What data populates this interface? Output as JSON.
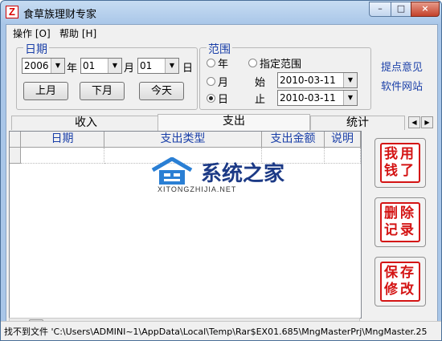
{
  "window": {
    "title": "食草族理财专家",
    "min": "–",
    "max": "□",
    "close": "×"
  },
  "menu": {
    "items": [
      "操作 [O]",
      "帮助 [H]"
    ]
  },
  "date_group": {
    "title": "日期",
    "year": "2006",
    "year_label": "年",
    "month": "01",
    "month_label": "月",
    "day": "01",
    "day_label": "日",
    "prev_month": "上月",
    "next_month": "下月",
    "today": "今天"
  },
  "range_group": {
    "title": "范围",
    "opt_year": "年",
    "opt_range": "指定范围",
    "opt_month": "月",
    "opt_day": "日",
    "start_label": "始",
    "end_label": "止",
    "start_date": "2010-03-11",
    "end_date": "2010-03-11",
    "selected": "日"
  },
  "links": {
    "feedback": "提点意见",
    "website": "软件网站"
  },
  "tabs": [
    "收入",
    "支出",
    "统计"
  ],
  "active_tab": "支出",
  "table": {
    "columns": [
      "日期",
      "支出类型",
      "支出金额",
      "说明"
    ]
  },
  "side_buttons": [
    {
      "name": "spend-button",
      "lines": [
        "我用",
        "钱了"
      ]
    },
    {
      "name": "delete-button",
      "lines": [
        "删除",
        "记录"
      ]
    },
    {
      "name": "save-edit-button",
      "lines": [
        "保存",
        "修改"
      ]
    }
  ],
  "watermark": {
    "text": "系统之家",
    "sub": "XITONGZHIJIA.NET"
  },
  "status": {
    "text": "找不到文件 'C:\\Users\\ADMINI~1\\AppData\\Local\\Temp\\Rar$EX01.685\\MngMasterPrj\\MngMaster.25"
  }
}
